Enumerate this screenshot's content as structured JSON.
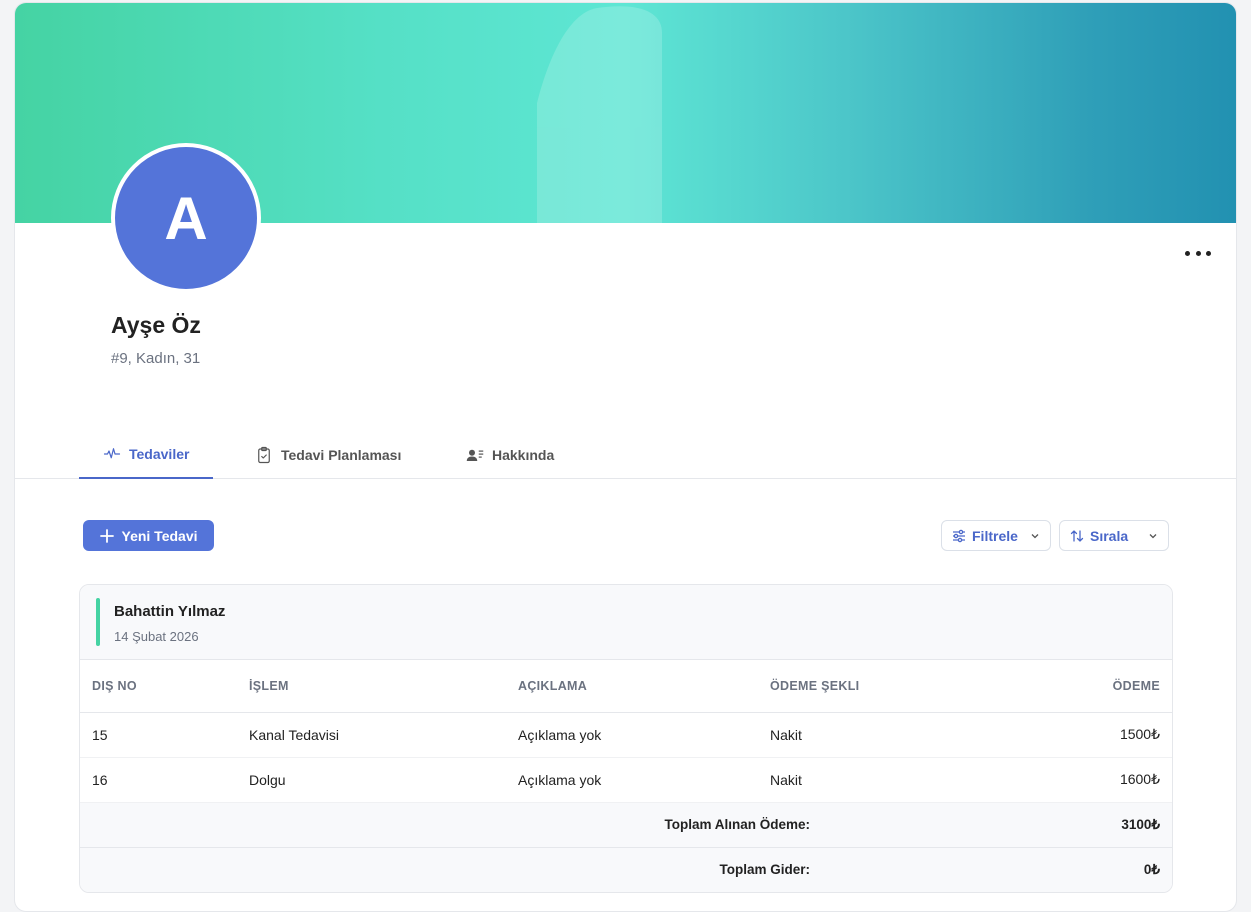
{
  "profile": {
    "initial": "A",
    "name": "Ayşe Öz",
    "meta": "#9, Kadın, 31"
  },
  "tabs": [
    {
      "label": "Tedaviler",
      "icon": "activity-icon",
      "active": true
    },
    {
      "label": "Tedavi Planlaması",
      "icon": "clipboard-check-icon",
      "active": false
    },
    {
      "label": "Hakkında",
      "icon": "user-list-icon",
      "active": false
    }
  ],
  "toolbar": {
    "new_label": "Yeni Tedavi",
    "filter_label": "Filtrele",
    "sort_label": "Sırala"
  },
  "treatment": {
    "doctor": "Bahattin Yılmaz",
    "date": "14 Şubat 2026",
    "columns": [
      "DIŞ NO",
      "İŞLEM",
      "AÇIKLAMA",
      "ÖDEME ŞEKLI",
      "ÖDEME"
    ],
    "rows": [
      {
        "tooth": "15",
        "procedure": "Kanal Tedavisi",
        "description": "Açıklama yok",
        "payment_method": "Nakit",
        "payment": "1500₺"
      },
      {
        "tooth": "16",
        "procedure": "Dolgu",
        "description": "Açıklama yok",
        "payment_method": "Nakit",
        "payment": "1600₺"
      }
    ],
    "total_received_label": "Toplam Alınan Ödeme:",
    "total_received": "3100₺",
    "total_expense_label": "Toplam Gider:",
    "total_expense": "0₺"
  },
  "colors": {
    "accent": "#5474d9",
    "tab_active": "#4a67c9",
    "doctor_bar": "#45d3a3"
  }
}
